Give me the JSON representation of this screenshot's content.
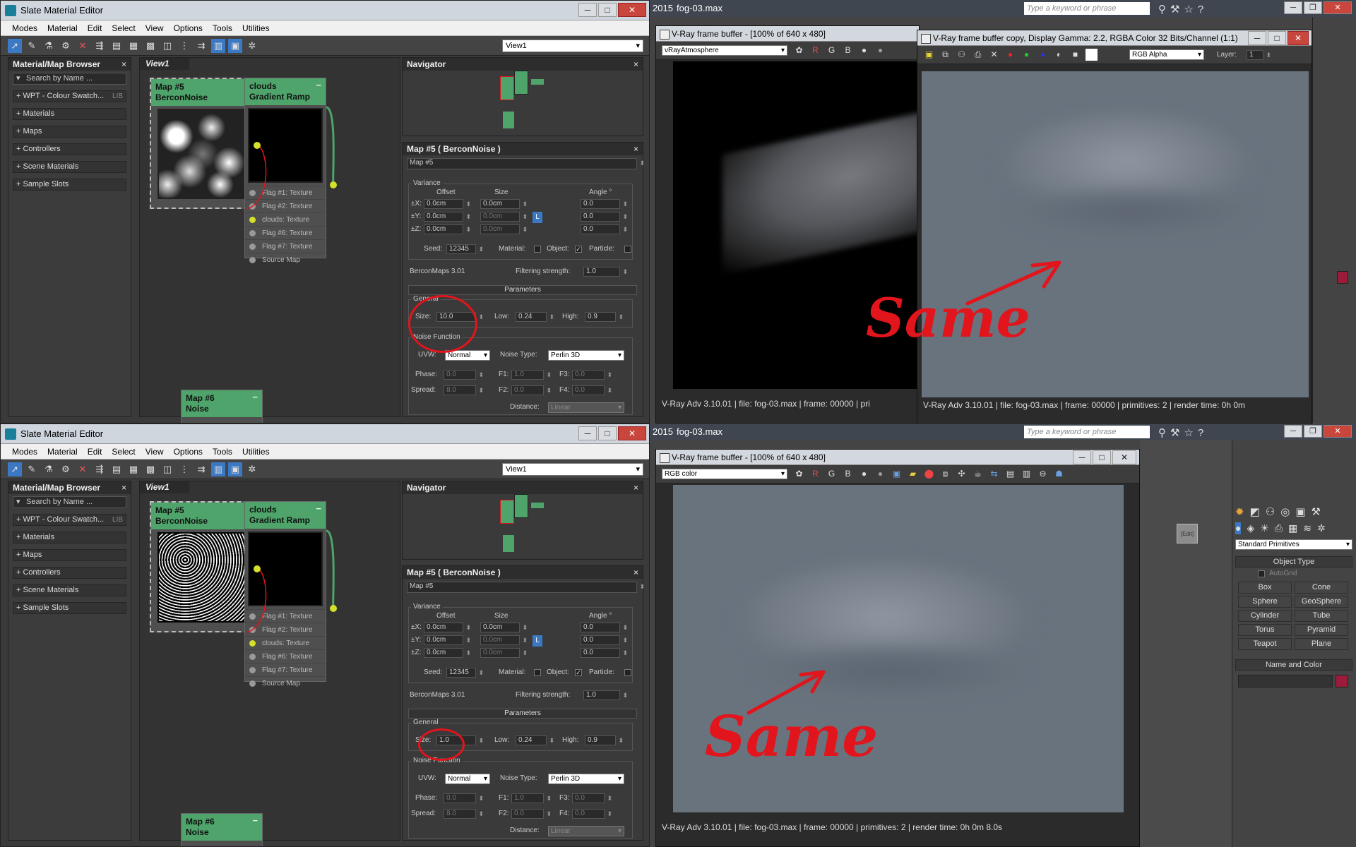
{
  "sme": {
    "title": "Slate Material Editor",
    "menu": [
      "Modes",
      "Material",
      "Edit",
      "Select",
      "View",
      "Options",
      "Tools",
      "Utilities"
    ],
    "view_select": "View1",
    "browser": {
      "title": "Material/Map Browser",
      "search_placeholder": "Search by Name ...",
      "items": [
        "+ WPT - Colour Swatch...",
        "+ Materials",
        "+ Maps",
        "+ Controllers",
        "+ Scene Materials",
        "+ Sample Slots"
      ],
      "lib": "LIB"
    },
    "view_tab": "View1",
    "node_map5": {
      "line1": "Map #5",
      "line2": "BerconNoise"
    },
    "node_clouds": {
      "line1": "clouds",
      "line2": "Gradient Ramp",
      "slots": [
        "Flag #1: Texture",
        "Flag #2: Texture",
        "clouds: Texture",
        "Flag #6: Texture",
        "Flag #7: Texture",
        "Source Map"
      ]
    },
    "node_map6": {
      "line1": "Map #6",
      "line2": "Noise"
    },
    "navigator": "Navigator",
    "props": {
      "header": "Map #5  ( BerconNoise )",
      "name_field": "Map #5",
      "variance": "Variance",
      "col_offset": "Offset",
      "col_size": "Size",
      "col_angle": "Angle °",
      "rows": [
        {
          "axis": "±X:",
          "offset": "0.0cm",
          "size": "0.0cm",
          "angle": "0.0"
        },
        {
          "axis": "±Y:",
          "offset": "0.0cm",
          "size": "0.0cm",
          "angle": "0.0"
        },
        {
          "axis": "±Z:",
          "offset": "0.0cm",
          "size": "0.0cm",
          "angle": "0.0"
        }
      ],
      "lock": "L",
      "seed_label": "Seed:",
      "seed": "12345",
      "material_label": "Material:",
      "object_label": "Object:",
      "particle_label": "Particle:",
      "version": "BerconMaps 3.01",
      "filtering_label": "Filtering strength:",
      "filtering": "1.0",
      "parameters": "Parameters",
      "general": "General",
      "size_label": "Size:",
      "low_label": "Low:",
      "low": "0.24",
      "high_label": "High:",
      "high": "0.9",
      "noise_function": "Noise Function",
      "uvw_label": "UVW:",
      "uvw": "Normal",
      "noise_type_label": "Noise Type:",
      "noise_type": "Perlin 3D",
      "phase_label": "Phase:",
      "phase": "0.0",
      "f1_label": "F1:",
      "f1": "1.0",
      "f3_label": "F3:",
      "f3": "0.0",
      "spread_label": "Spread:",
      "spread": "8.0",
      "f2_label": "F2:",
      "f2": "0.0",
      "f4_label": "F4:",
      "f4": "0.0",
      "distance_label": "Distance:",
      "distance": "Linear"
    }
  },
  "top": {
    "size_value": "10.0",
    "max_bar": {
      "left": "2015",
      "file": "fog-03.max",
      "search": "Type a keyword or phrase"
    },
    "vfb1": {
      "title": "V-Ray frame buffer - [100% of 640 x 480]",
      "channel": "vRayAtmosphere",
      "rgb": [
        "R",
        "G",
        "B"
      ],
      "status": "V-Ray Adv 3.10.01  |  file: fog-03.max  |  frame: 00000  |  pri"
    },
    "vfb2": {
      "title": "V-Ray frame buffer copy, Display Gamma: 2.2, RGBA Color 32 Bits/Channel (1:1)",
      "channel": "RGB Alpha",
      "layer_label": "Layer:",
      "layer": "1",
      "status": "V-Ray Adv 3.10.01  |  file: fog-03.max  |  frame: 00000  |  primitives: 2  |  render time:  0h  0m"
    },
    "annotation": "Same"
  },
  "bottom": {
    "size_value": "1.0",
    "max_bar": {
      "left": "2015",
      "file": "fog-03.max",
      "search": "Type a keyword or phrase"
    },
    "vfb": {
      "title": "V-Ray frame buffer - [100% of 640 x 480]",
      "channel": "RGB color",
      "rgb": [
        "R",
        "G",
        "B"
      ],
      "status": "V-Ray Adv 3.10.01  |  file: fog-03.max  |  frame: 00000  |  primitives: 2  |  render time:  0h  0m  8.0s"
    },
    "cmd": {
      "dropdown": "Standard Primitives",
      "object_type": "Object Type",
      "autogrid": "AutoGrid",
      "buttons": [
        "Box",
        "Cone",
        "Sphere",
        "GeoSphere",
        "Cylinder",
        "Tube",
        "Torus",
        "Pyramid",
        "Teapot",
        "Plane"
      ],
      "name_color": "Name and Color",
      "viewport_label": "[Edit]"
    },
    "annotation": "Same"
  },
  "colors": {
    "annotation_red": "#e2141c",
    "node_green": "#4ea46a",
    "slot_yellow": "#d4e02a"
  },
  "icons": [
    "app-icon",
    "arrow-icon",
    "eyedropper-icon",
    "delete-icon",
    "lock-icon",
    "search-icon",
    "help-icon",
    "star-icon",
    "close-icon",
    "save-icon"
  ]
}
